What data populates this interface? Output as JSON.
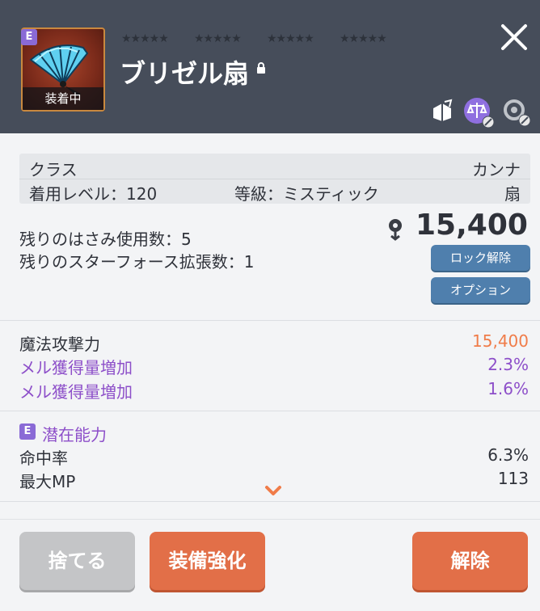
{
  "item": {
    "rank": "E",
    "equipped_label": "装着中",
    "name": "ブリゼル扇",
    "star_groups": [
      "★★★★★",
      "★★★★★",
      "★★★★★",
      "★★★★★"
    ]
  },
  "info": {
    "class_label": "クラス",
    "class_value": "カンナ",
    "level_label": "着用レベル：120",
    "grade_label": "等級：ミスティック",
    "type_value": "扇"
  },
  "usage": {
    "scissors": "残りのはさみ使用数：5",
    "starforce_ext": "残りのスターフォース拡張数：1",
    "price": "15,400",
    "unlock_button": "ロック解除",
    "option_button": "オプション"
  },
  "stats": [
    {
      "label": "魔法攻撃力",
      "value": "15,400",
      "label_color": "#2f323a",
      "value_color": "#f07c49"
    },
    {
      "label": "メル獲得量増加",
      "value": "2.3%",
      "label_color": "#8d4fc9",
      "value_color": "#8d4fc9"
    },
    {
      "label": "メル獲得量増加",
      "value": "1.6%",
      "label_color": "#8d4fc9",
      "value_color": "#8d4fc9"
    }
  ],
  "potential": {
    "rank": "E",
    "title": "潜在能力",
    "lines": [
      {
        "label": "命中率",
        "value": "6.3%"
      },
      {
        "label": "最大MP",
        "value": "113"
      }
    ]
  },
  "footer": {
    "discard": "捨てる",
    "enhance": "装備強化",
    "unequip": "解除"
  },
  "colors": {
    "header_bg": "#464d5a",
    "accent_orange": "#e26f48",
    "accent_blue": "#4f7fad",
    "potential_purple": "#8d4fc9"
  },
  "icons": [
    "fan-item-icon",
    "lock-icon",
    "close-icon",
    "share-icon",
    "trade-balance-icon",
    "reset-icon",
    "meso-icon",
    "chevron-down-icon"
  ]
}
